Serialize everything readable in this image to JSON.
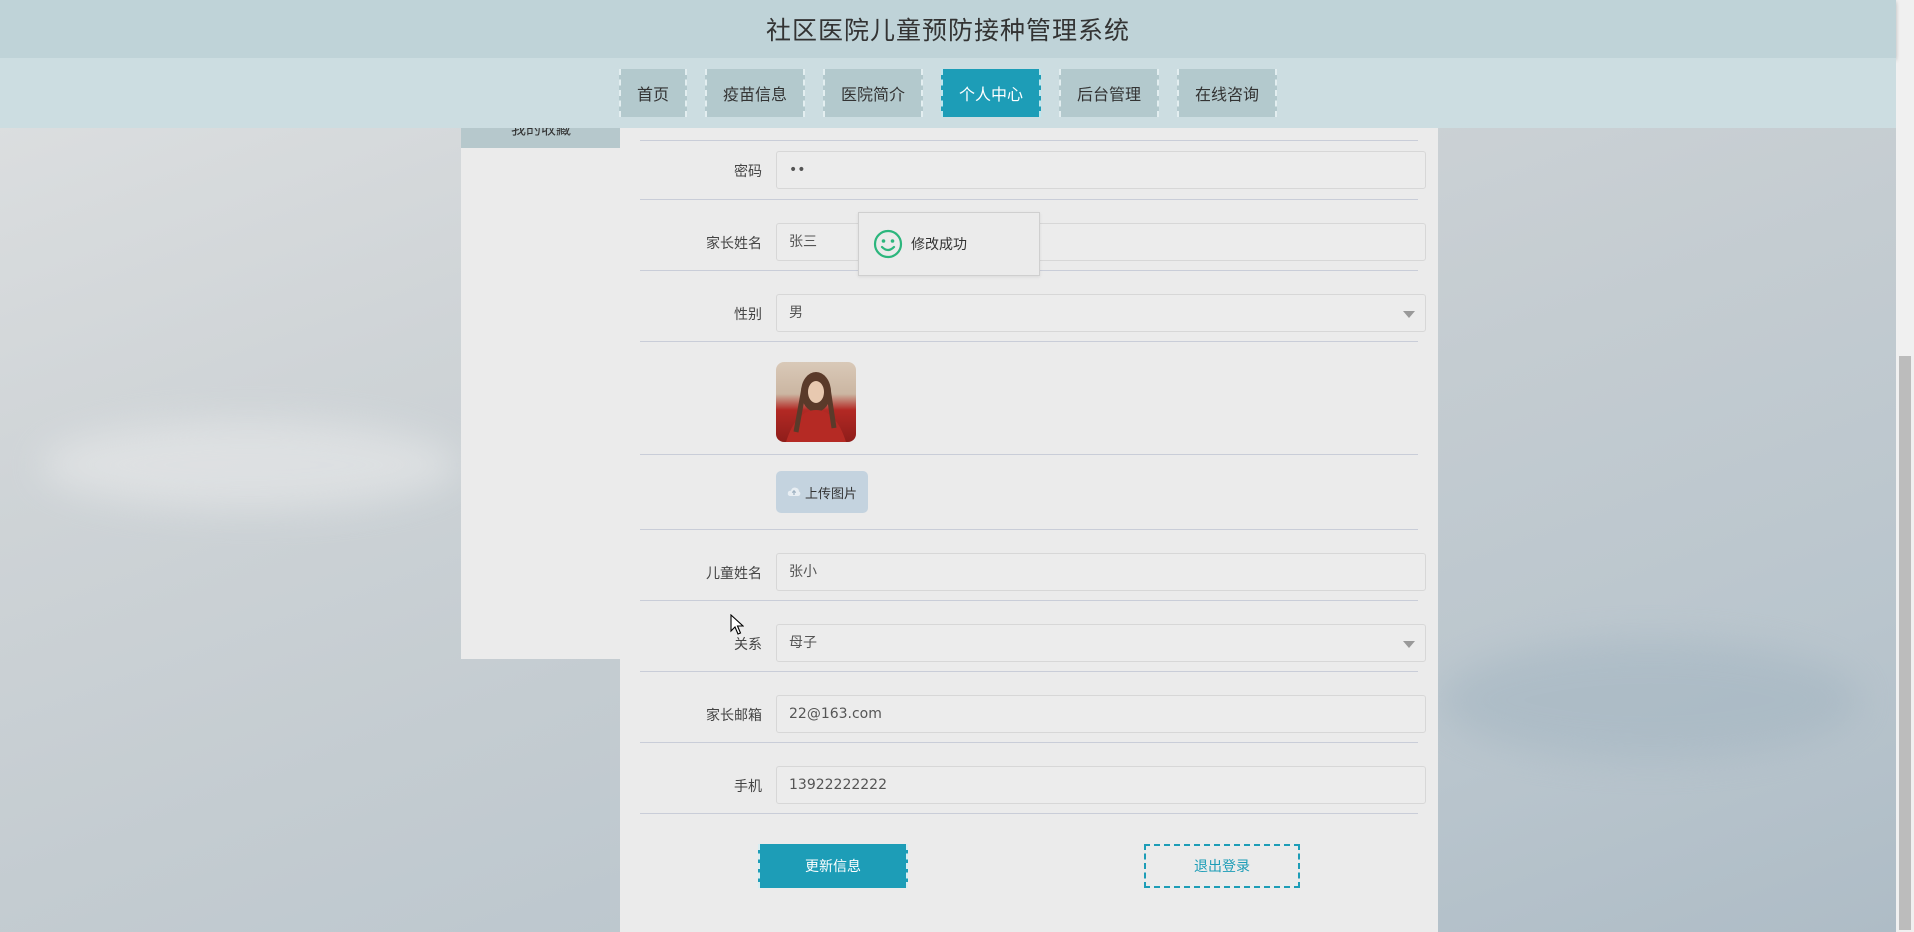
{
  "app": {
    "title": "社区医院儿童预防接种管理系统"
  },
  "nav": {
    "items": [
      {
        "label": "首页",
        "active": false
      },
      {
        "label": "疫苗信息",
        "active": false
      },
      {
        "label": "医院简介",
        "active": false
      },
      {
        "label": "个人中心",
        "active": true
      },
      {
        "label": "后台管理",
        "active": false
      },
      {
        "label": "在线咨询",
        "active": false
      }
    ]
  },
  "sidebar": {
    "partial_item_label": "我的收藏"
  },
  "form": {
    "password": {
      "label": "密码",
      "value": "••"
    },
    "parent_name": {
      "label": "家长姓名",
      "value": "张三"
    },
    "gender": {
      "label": "性别",
      "value": "男"
    },
    "upload": {
      "label": "上传图片"
    },
    "child_name": {
      "label": "儿童姓名",
      "value": "张小"
    },
    "relation": {
      "label": "关系",
      "value": "母子"
    },
    "email": {
      "label": "家长邮箱",
      "value": "22@163.com"
    },
    "phone": {
      "label": "手机",
      "value": "13922222222"
    }
  },
  "actions": {
    "update": "更新信息",
    "logout": "退出登录"
  },
  "toast": {
    "message": "修改成功"
  },
  "colors": {
    "accent": "#1d9db7",
    "header": "#bfd3d8",
    "nav": "#ccdde1",
    "success": "#2cb67d"
  }
}
